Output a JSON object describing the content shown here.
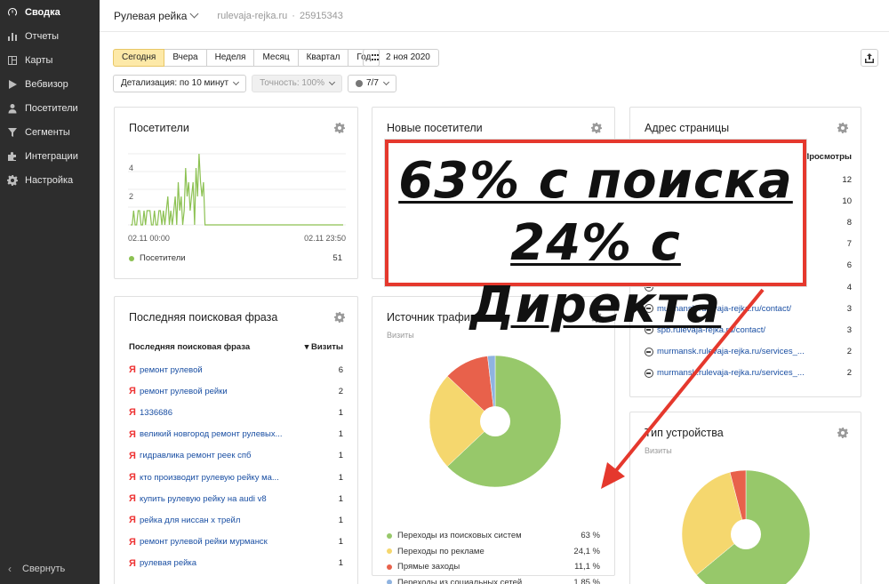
{
  "sidebar": {
    "items": [
      {
        "label": "Сводка",
        "icon": "dashboard-icon",
        "active": true
      },
      {
        "label": "Отчеты",
        "icon": "reports-icon"
      },
      {
        "label": "Карты",
        "icon": "maps-icon"
      },
      {
        "label": "Вебвизор",
        "icon": "play-icon"
      },
      {
        "label": "Посетители",
        "icon": "user-icon"
      },
      {
        "label": "Сегменты",
        "icon": "funnel-icon"
      },
      {
        "label": "Интеграции",
        "icon": "puzzle-icon"
      },
      {
        "label": "Настройка",
        "icon": "gear-icon"
      }
    ],
    "collapse_label": "Свернуть"
  },
  "header": {
    "counter_name": "Рулевая рейка",
    "host": "rulevaja-rejka.ru",
    "separator": "·",
    "counter_id": "25915343"
  },
  "toolbar": {
    "periods": [
      "Сегодня",
      "Вчера",
      "Неделя",
      "Месяц",
      "Квартал",
      "Год"
    ],
    "active_period": "Сегодня",
    "date": "2 ноя 2020",
    "detail": "Детализация: по 10 минут",
    "accuracy": "Точность: 100%",
    "segments": "7/7"
  },
  "widgets": {
    "visitors": {
      "title": "Посетители",
      "y_ticks": [
        "4",
        "2"
      ],
      "x_start": "02.11 00:00",
      "x_end": "02.11 23:50",
      "legend_label": "Посетители",
      "legend_value": "51",
      "color": "#8cc152"
    },
    "new_visitors": {
      "title": "Новые посетители"
    },
    "page_address": {
      "title": "Адрес страницы",
      "col_header": "▾ Просмотры",
      "rows": [
        {
          "url": "",
          "value": "12"
        },
        {
          "url": "",
          "value": "10"
        },
        {
          "url": "",
          "value": "8"
        },
        {
          "url": "",
          "value": "7"
        },
        {
          "url": "",
          "value": "6"
        },
        {
          "url": "",
          "value": "4"
        },
        {
          "url": "murmansk.rulevaja-rejka.ru/contact/",
          "value": "3"
        },
        {
          "url": "spb.rulevaja-rejka.ru/contact/",
          "value": "3"
        },
        {
          "url": "murmansk.rulevaja-rejka.ru/services_...",
          "value": "2"
        },
        {
          "url": "murmansk.rulevaja-rejka.ru/services_...",
          "value": "2"
        }
      ]
    },
    "search_phrase": {
      "title": "Последняя поисковая фраза",
      "col1": "Последняя поисковая фраза",
      "col2": "▾ Визиты",
      "rows": [
        {
          "phrase": "ремонт рулевой",
          "value": "6"
        },
        {
          "phrase": "ремонт рулевой рейки",
          "value": "2"
        },
        {
          "phrase": "1336686",
          "value": "1"
        },
        {
          "phrase": "великий новгород ремонт рулевых...",
          "value": "1"
        },
        {
          "phrase": "гидравлика ремонт реек спб",
          "value": "1"
        },
        {
          "phrase": "кто производит рулевую рейку ма...",
          "value": "1"
        },
        {
          "phrase": "купить рулевую рейку на audi v8",
          "value": "1"
        },
        {
          "phrase": "рейка для ниссан х трейл",
          "value": "1"
        },
        {
          "phrase": "ремонт рулевой рейки мурманск",
          "value": "1"
        },
        {
          "phrase": "рулевая рейка",
          "value": "1"
        }
      ]
    },
    "traffic_source": {
      "title": "Источник трафика",
      "subtitle": "Визиты",
      "legend": [
        {
          "label": "Переходы из поисковых систем",
          "value": "63 %",
          "color": "#97c86a"
        },
        {
          "label": "Переходы по рекламе",
          "value": "24,1 %",
          "color": "#f5d76e"
        },
        {
          "label": "Прямые заходы",
          "value": "11,1 %",
          "color": "#e8614b"
        },
        {
          "label": "Переходы из социальных сетей",
          "value": "1,85 %",
          "color": "#8fb3e0"
        }
      ]
    },
    "device_type": {
      "title": "Тип устройства",
      "subtitle": "Визиты"
    }
  },
  "chart_data": [
    {
      "type": "line",
      "title": "Посетители",
      "series": [
        {
          "name": "Посетители",
          "values": [
            0,
            0,
            1,
            0,
            0,
            1,
            1,
            0,
            0,
            1,
            0,
            1,
            1,
            1,
            0,
            0,
            1,
            0,
            0,
            1,
            1,
            0,
            1,
            0,
            1,
            2,
            0,
            1,
            0,
            1,
            2,
            0,
            3,
            1,
            2,
            0,
            1,
            4,
            2,
            3,
            1,
            2,
            3,
            0,
            4,
            2,
            5,
            3,
            2,
            3,
            0,
            0,
            0,
            0,
            0,
            0,
            0,
            0,
            0,
            0,
            0,
            0,
            0,
            0,
            0,
            0,
            0,
            0,
            0,
            0,
            0,
            0,
            0,
            0,
            0,
            0,
            0,
            0,
            0,
            0,
            0,
            0,
            0,
            0,
            0,
            0,
            0,
            0,
            0,
            0,
            0,
            0,
            0,
            0,
            0,
            0,
            0,
            0,
            0,
            0,
            0,
            0,
            0,
            0,
            0,
            0,
            0,
            0,
            0,
            0,
            0,
            0,
            0,
            0,
            0,
            0,
            0,
            0,
            0,
            0,
            0,
            0,
            0,
            0,
            0,
            0,
            0,
            0,
            0,
            0,
            0,
            0,
            0,
            0,
            0,
            0,
            0,
            0,
            0,
            0,
            0,
            0,
            0,
            0
          ]
        }
      ],
      "ylim": [
        0,
        5
      ]
    },
    {
      "type": "pie",
      "title": "Источник трафика",
      "categories": [
        "Переходы из поисковых систем",
        "Переходы по рекламе",
        "Прямые заходы",
        "Переходы из социальных сетей"
      ],
      "values": [
        63,
        24.1,
        11.1,
        1.85
      ]
    },
    {
      "type": "pie",
      "title": "Тип устройства",
      "categories": [
        "",
        "",
        ""
      ],
      "values": [
        64,
        32,
        4
      ]
    }
  ],
  "overlay": {
    "line1": "63% с поиска",
    "line2": "24% с Директа",
    "color": "#e5382d"
  }
}
